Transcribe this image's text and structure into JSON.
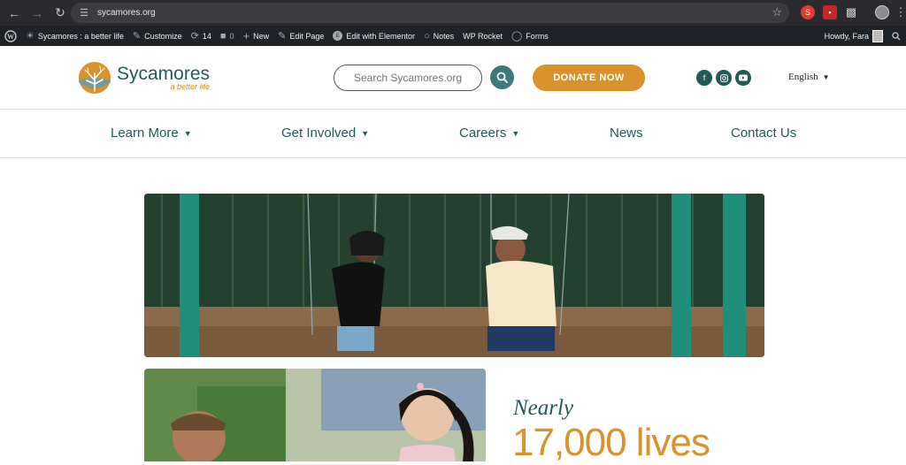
{
  "browser": {
    "url": "sycamores.org"
  },
  "adminbar": {
    "site_name": "Sycamores : a better life",
    "customize": "Customize",
    "updates_count": "14",
    "comments_count": "0",
    "new": "New",
    "edit_page": "Edit Page",
    "edit_elementor": "Edit with Elementor",
    "notes": "Notes",
    "wp_rocket": "WP Rocket",
    "forms": "Forms",
    "howdy": "Howdy, Fara"
  },
  "header": {
    "logo_name": "Sycamores",
    "logo_tagline": "a better life",
    "search_placeholder": "Search Sycamores.org",
    "donate_label": "DONATE NOW",
    "language": "English"
  },
  "nav": {
    "items": [
      {
        "label": "Learn More",
        "dropdown": true
      },
      {
        "label": "Get Involved",
        "dropdown": true
      },
      {
        "label": "Careers",
        "dropdown": true
      },
      {
        "label": "News",
        "dropdown": false
      },
      {
        "label": "Contact Us",
        "dropdown": false
      }
    ]
  },
  "content": {
    "stat_prefix": "Nearly",
    "stat_value": "17,000 lives"
  },
  "colors": {
    "brand_teal": "#1f5b57",
    "brand_orange": "#d9922c"
  }
}
